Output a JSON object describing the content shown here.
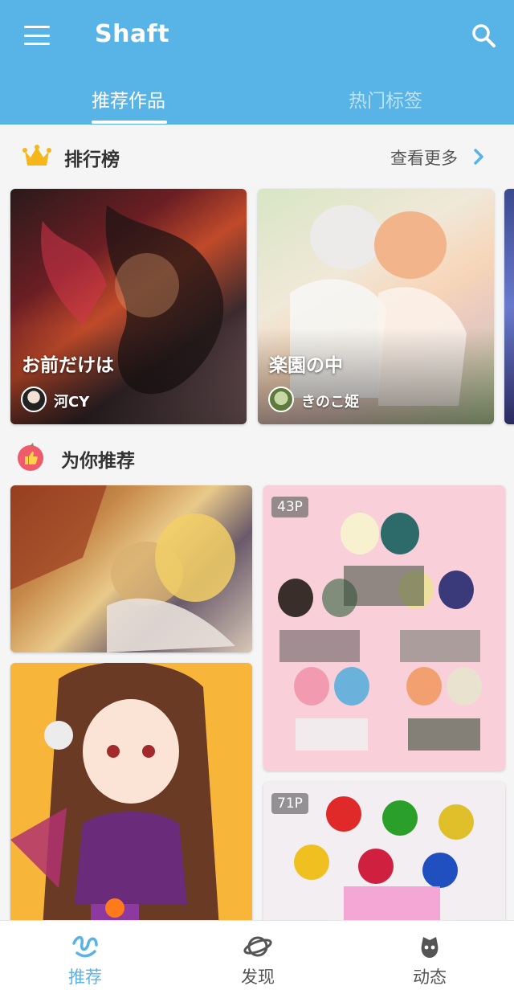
{
  "app": {
    "title": "Shaft",
    "accent_color": "#58b4e6"
  },
  "tabs": [
    {
      "label": "推荐作品",
      "active": true
    },
    {
      "label": "热门标签",
      "active": false
    }
  ],
  "ranking": {
    "title": "排行榜",
    "more_label": "查看更多",
    "icon": "crown-icon",
    "cards": [
      {
        "title": "お前だけは",
        "author": "河CY"
      },
      {
        "title": "楽園の中",
        "author": "きのこ姫"
      }
    ]
  },
  "recommend": {
    "title": "为你推荐",
    "icon": "thumbs-up-icon",
    "cards": [
      {
        "pages": ""
      },
      {
        "pages": ""
      },
      {
        "pages": "43P"
      },
      {
        "pages": "71P"
      }
    ]
  },
  "bottom_nav": [
    {
      "label": "推荐",
      "icon": "recommend-icon",
      "active": true
    },
    {
      "label": "发现",
      "icon": "planet-icon",
      "active": false
    },
    {
      "label": "动态",
      "icon": "feed-icon",
      "active": false
    }
  ]
}
